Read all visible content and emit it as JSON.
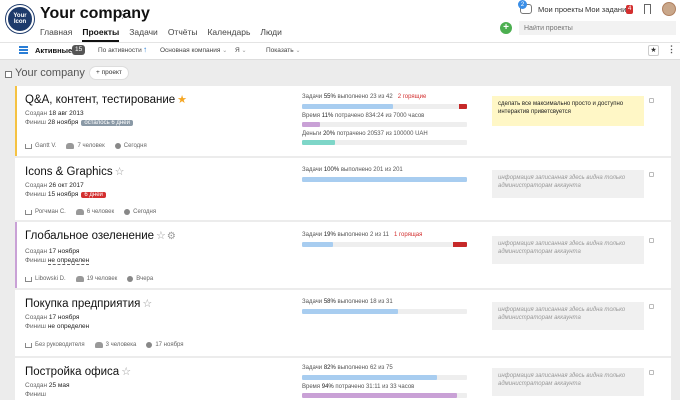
{
  "header": {
    "logo_text": "Your Icon",
    "company": "Your company",
    "nav": [
      "Главная",
      "Проекты",
      "Задачи",
      "Отчёты",
      "Календарь",
      "Люди"
    ],
    "chat_count": "2",
    "my_projects": "Мои проекты",
    "my_tasks": "Мои задания",
    "tasks_count": "4",
    "add_symbol": "+",
    "search_placeholder": "Найти проекты"
  },
  "filters": {
    "active": "Активные",
    "active_count": "15",
    "sort": "По активности",
    "company": "Основная компания",
    "me": "Я",
    "show": "Показать"
  },
  "section": {
    "title": "Your company",
    "add_project": "+ проект"
  },
  "projects": [
    {
      "title": "Q&A, контент, тестирование",
      "starred": true,
      "created_label": "Создан",
      "created": "18 авг 2013",
      "finish_label": "Финиш",
      "finish": "28 ноября",
      "finish_badge": "осталось 6 дней",
      "owner": "Gantt V.",
      "people": "7 человек",
      "activity": "Сегодня",
      "tasks_label": "Задачи",
      "tasks_pct": "55%",
      "tasks_done": "выполнено 23 из 42",
      "tasks_hot": "2 горящие",
      "tasks_value": 55,
      "time_label": "Время",
      "time_pct": "11%",
      "time_used": "потрачено 834:24 из 7000 часов",
      "time_value": 11,
      "money_label": "Деньги",
      "money_pct": "20%",
      "money_used": "потрачено 20537 из 100000 UAH",
      "money_value": 20,
      "note": "сделать все максимально просто и доступно интерактив приветсвуется"
    },
    {
      "title": "Icons & Graphics",
      "created_label": "Создан",
      "created": "26 окт 2017",
      "finish_label": "Финиш",
      "finish": "15 ноября",
      "finish_badge": "6 дней",
      "owner": "Рогчман С.",
      "people": "6 человек",
      "activity": "Сегодня",
      "tasks_label": "Задачи",
      "tasks_pct": "100%",
      "tasks_done": "выполнено 201 из 201",
      "tasks_value": 100,
      "note": "информация записанная здесь видна только администраторам аккаунта"
    },
    {
      "title": "Глобальное озеленение",
      "created_label": "Создан",
      "created": "17 ноября",
      "finish_label": "Финиш",
      "finish": "не определен",
      "owner": "Libowski D.",
      "people": "19 человек",
      "activity": "Вчера",
      "tasks_label": "Задачи",
      "tasks_pct": "19%",
      "tasks_done": "выполнено 2 из 11",
      "tasks_hot": "1 горящая",
      "tasks_value": 19,
      "note": "информация записанная здесь видна только администраторам аккаунта"
    },
    {
      "title": "Покупка предприятия",
      "created_label": "Создан",
      "created": "17 ноября",
      "finish_label": "Финиш",
      "finish": "не определен",
      "owner": "Без руководителя",
      "people": "3 человека",
      "activity": "17 ноября",
      "tasks_label": "Задачи",
      "tasks_pct": "58%",
      "tasks_done": "выполнено 18 из 31",
      "tasks_value": 58,
      "note": "информация записанная здесь видна только администраторам аккаунта"
    },
    {
      "title": "Постройка офиса",
      "created_label": "Создан",
      "created": "25 мая",
      "finish_label": "Финиш",
      "tasks_label": "Задачи",
      "tasks_pct": "82%",
      "tasks_done": "выполнено 62 из 75",
      "tasks_value": 82,
      "time_label": "Время",
      "time_pct": "94%",
      "time_used": "потрачено 31:11 из 33 часов",
      "time_value": 94,
      "note": "информация записанная здесь видна только администраторам аккаунта"
    }
  ],
  "colors": {
    "tasks_bar": "#a8cdf0",
    "time_bar": "#c9a1d6",
    "money_bar": "#7ed6c8",
    "hot": "#c62828",
    "card1_border": "#f5c242",
    "card3_border": "#c9a1d6"
  }
}
